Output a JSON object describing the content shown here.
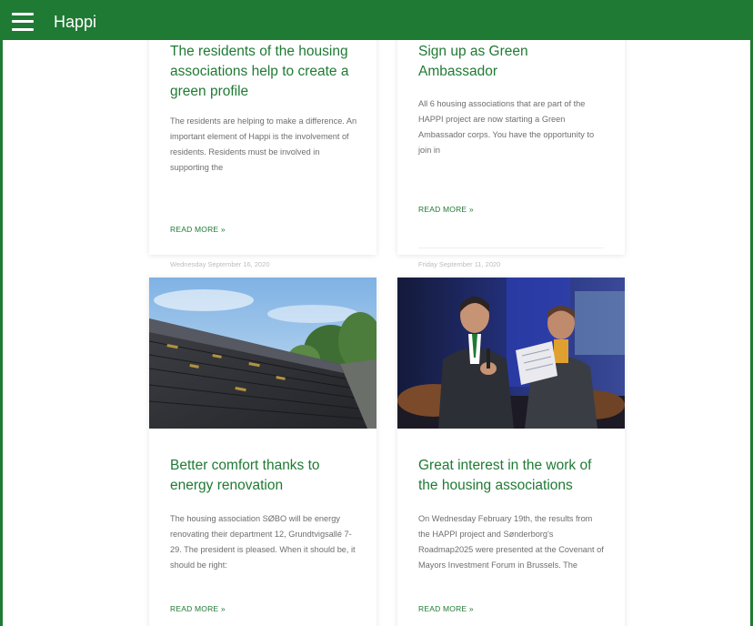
{
  "header": {
    "brand": "Happi"
  },
  "colors": {
    "brand_green": "#1f7a34",
    "text_gray": "#6e6e6e",
    "date_gray": "#bdbdbd"
  },
  "cards": [
    {
      "title": "The residents of the housing associations help to create a green profile",
      "excerpt": "The residents are helping to make a difference. An important element of Happi is the involvement of residents. Residents must be involved in supporting the",
      "read_more": "READ MORE »",
      "date": "Wednesday September 16, 2020"
    },
    {
      "title": "Sign up as Green Ambassador",
      "excerpt": "All 6 housing associations that are part of the HAPPI project are now starting a Green Ambassador corps. You have the opportunity to join in",
      "read_more": "READ MORE »",
      "date": "Friday September 11, 2020"
    },
    {
      "image_icon": "roof-photo",
      "title": "Better comfort thanks to energy renovation",
      "excerpt": "The housing association SØBO will be energy renovating their department 12, Grundtvigsallé 7-29. The president is pleased. When it should be, it should be right:",
      "read_more": "READ MORE »"
    },
    {
      "image_icon": "conference-photo",
      "title": "Great interest in the work of the housing associations",
      "excerpt": "On Wednesday February 19th, the results from the HAPPI project and Sønderborg's Roadmap2025 were presented at the Covenant of Mayors Investment Forum in Brussels. The",
      "read_more": "READ MORE »"
    }
  ]
}
